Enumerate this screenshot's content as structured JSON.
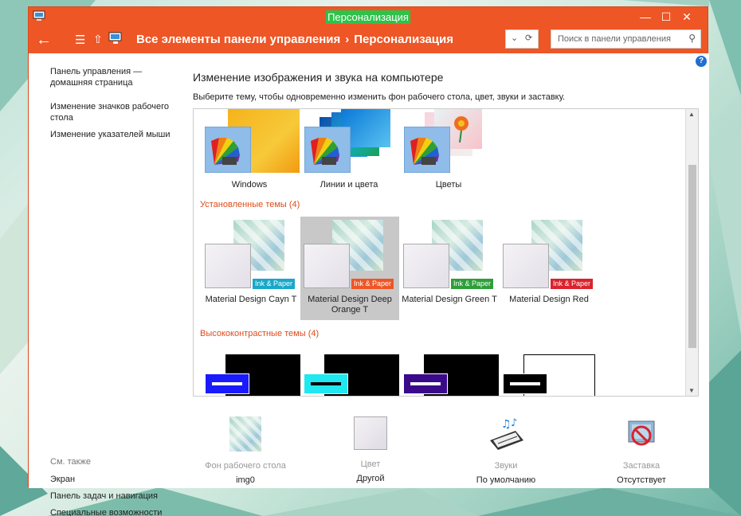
{
  "window": {
    "title": "Персонализация"
  },
  "address": {
    "crumb1": "Все элементы панели управления",
    "crumb_sep": "›",
    "crumb2": "Персонализация",
    "search_placeholder": "Поиск в панели управления"
  },
  "sidebar": {
    "links": [
      "Панель управления —\nдомашняя страница",
      "Изменение значков рабочего\nстола",
      "Изменение указателей мыши"
    ],
    "see_also": "См. также",
    "see_also_links": [
      "Экран",
      "Панель задач и навигация",
      "Специальные возможности"
    ]
  },
  "main": {
    "heading": "Изменение изображения и звука на компьютере",
    "subtitle": "Выберите тему, чтобы одновременно изменить фон рабочего стола, цвет, звуки и заставку.",
    "default_themes": [
      "Windows",
      "Линии и цвета",
      "Цветы"
    ],
    "installed_section": "Установленные темы (4)",
    "installed_themes": [
      {
        "label": "Material Design Cayn T",
        "badge": "Ink & Paper",
        "badge_color": "#1aa7c9"
      },
      {
        "label": "Material Design Deep Orange T",
        "badge": "Ink & Paper",
        "badge_color": "#ee5626"
      },
      {
        "label": "Material Design Green T",
        "badge": "Ink & Paper",
        "badge_color": "#2e9e3a"
      },
      {
        "label": "Material Design Red",
        "badge": "Ink & Paper",
        "badge_color": "#d9232e"
      }
    ],
    "hc_section": "Высококонтрастные темы (4)"
  },
  "bottom": [
    {
      "title": "Фон рабочего стола",
      "value": "img0"
    },
    {
      "title": "Цвет",
      "value": "Другой"
    },
    {
      "title": "Звуки",
      "value": "По умолчанию"
    },
    {
      "title": "Заставка",
      "value": "Отсутствует"
    }
  ],
  "colors": {
    "accent": "#ee5626",
    "title_highlight": "#2ec24a",
    "section": "#e04a1a"
  }
}
